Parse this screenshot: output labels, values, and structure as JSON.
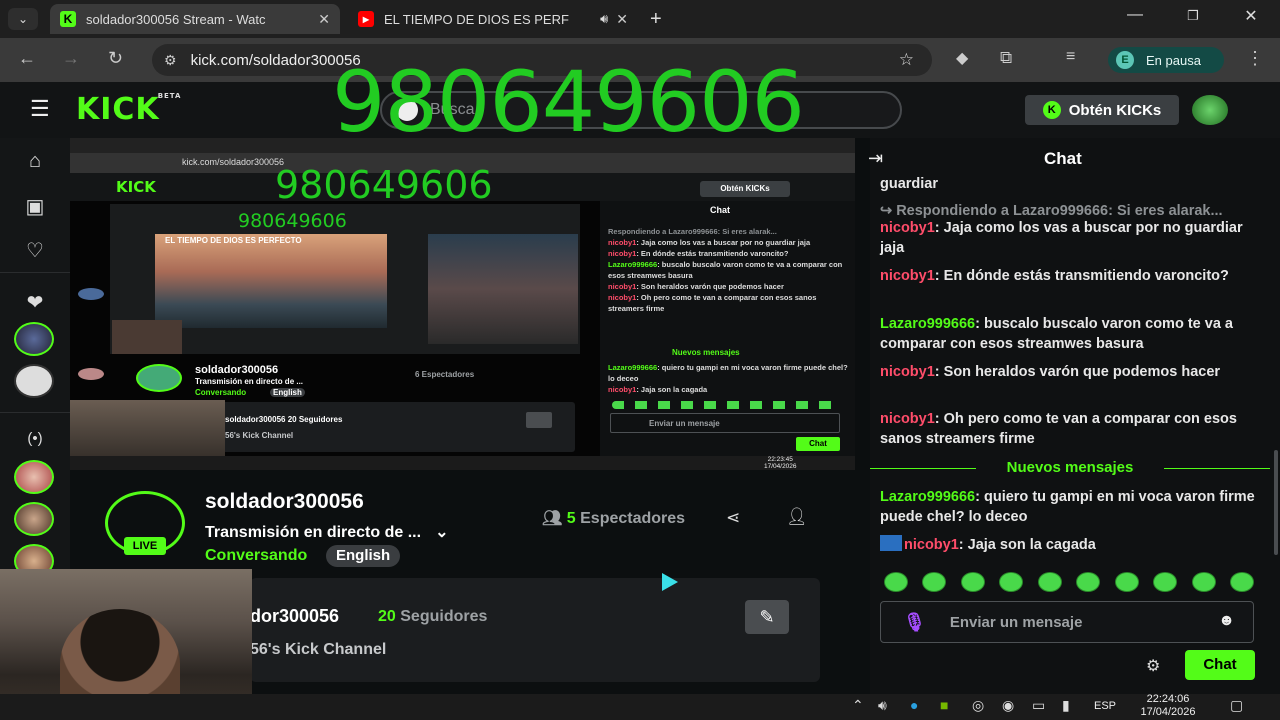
{
  "browser": {
    "tabs": [
      {
        "title": "soldador300056 Stream - Watc",
        "icon": "kick-favicon"
      },
      {
        "title": "EL TIEMPO DE DIOS ES PERF",
        "icon": "youtube-favicon"
      }
    ],
    "url": "kick.com/soldador300056",
    "profile_badge": "E",
    "profile_status": "En pausa"
  },
  "header": {
    "logo": "KICK",
    "logo_badge": "BETA",
    "search_placeholder": "Busca",
    "overlay_number": "980649606",
    "kicks_button": "Obtén KICKs"
  },
  "player_mirror": {
    "overlay_number": "980649606",
    "overlay_number_2": "980649606",
    "url": "kick.com/soldador300056",
    "kicks_button": "Obtén KICKs",
    "video_title": "EL TIEMPO DE DIOS ES PERFECTO",
    "username": "soldador300056",
    "stream_title": "Transmisión en directo de ...",
    "category": "Conversando",
    "language": "English",
    "viewers": "6 Espectadores",
    "followers": "soldador300056  20 Seguidores",
    "channel_desc": "56's Kick Channel",
    "chat_title": "Chat",
    "new_messages": "Nuevos mensajes",
    "chat_placeholder": "Enviar un mensaje",
    "send": "Chat",
    "clock_time": "22:23:45",
    "clock_date": "17/04/2026"
  },
  "stream": {
    "username": "soldador300056",
    "title": "Transmisión en directo de ...",
    "category": "Conversando",
    "language": "English",
    "live_label": "LIVE",
    "viewers_count": "5",
    "viewers_label": "Espectadores",
    "about_name": "dor300056",
    "followers_count": "20",
    "followers_label": "Seguidores",
    "about_desc": "56's Kick Channel"
  },
  "chat": {
    "title": "Chat",
    "messages": [
      {
        "user": "",
        "text": "guardiar"
      },
      {
        "reply": "Respondiendo a Lazaro999666: Si eres alarak..."
      },
      {
        "user": "nicoby1",
        "color": "#ff4d6a",
        "text": ": Jaja como los vas a buscar por no guardiar jaja"
      },
      {
        "user": "nicoby1",
        "color": "#ff4d6a",
        "text": ": En dónde estás transmitiendo varoncito?"
      },
      {
        "user": "Lazaro999666",
        "color": "#53fc18",
        "text": ": buscalo buscalo varon como te va a comparar con esos streamwes basura"
      },
      {
        "user": "nicoby1",
        "color": "#ff4d6a",
        "text": ": Son heraldos varón que podemos hacer"
      },
      {
        "user": "nicoby1",
        "color": "#ff4d6a",
        "text": ": Oh pero como te van a comparar con esos sanos streamers firme"
      },
      {
        "user": "Lazaro999666",
        "color": "#53fc18",
        "text": ": quiero tu gampi en mi voca varon firme puede chel? lo deceo"
      },
      {
        "user": "nicoby1",
        "color": "#ff4d6a",
        "text": ": Jaja son la cagada"
      }
    ],
    "new_messages_divider": "Nuevos mensajes",
    "input_placeholder": "Enviar un mensaje",
    "send_label": "Chat"
  },
  "taskbar": {
    "language": "ESP",
    "time": "22:24:06",
    "date": "17/04/2026"
  },
  "colors": {
    "kick_green": "#53fc18",
    "overlay_green": "#22cc22",
    "user_red": "#ff4d6a",
    "background": "#0b0e0f"
  }
}
